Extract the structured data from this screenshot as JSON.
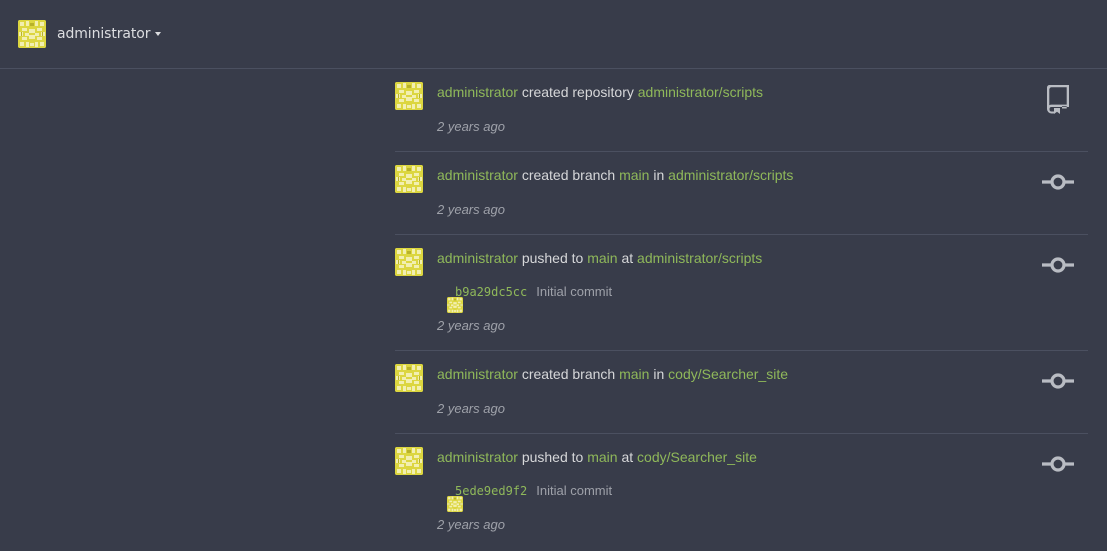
{
  "header": {
    "user_name": "administrator",
    "avatar_icon": "identicon"
  },
  "colors": {
    "background": "#383c4a",
    "link": "#8fb85a",
    "muted": "#9ea1a9",
    "text": "#d6d7d9",
    "icon": "#b9bcc3",
    "divider": "#4b5060"
  },
  "feed": [
    {
      "actor": "administrator",
      "verb": "created repository",
      "target": "administrator/scripts",
      "time": "2 years ago",
      "icon": "repo-icon"
    },
    {
      "actor": "administrator",
      "verb": "created branch",
      "branch": "main",
      "prep": "in",
      "target": "administrator/scripts",
      "time": "2 years ago",
      "icon": "git-commit-icon"
    },
    {
      "actor": "administrator",
      "verb": "pushed to",
      "branch": "main",
      "prep": "at",
      "target": "administrator/scripts",
      "commit_sha": "b9a29dc5cc",
      "commit_message": "Initial commit",
      "time": "2 years ago",
      "icon": "git-commit-icon"
    },
    {
      "actor": "administrator",
      "verb": "created branch",
      "branch": "main",
      "prep": "in",
      "target": "cody/Searcher_site",
      "time": "2 years ago",
      "icon": "git-commit-icon"
    },
    {
      "actor": "administrator",
      "verb": "pushed to",
      "branch": "main",
      "prep": "at",
      "target": "cody/Searcher_site",
      "commit_sha": "5ede9ed9f2",
      "commit_message": "Initial commit",
      "time": "2 years ago",
      "icon": "git-commit-icon"
    }
  ]
}
